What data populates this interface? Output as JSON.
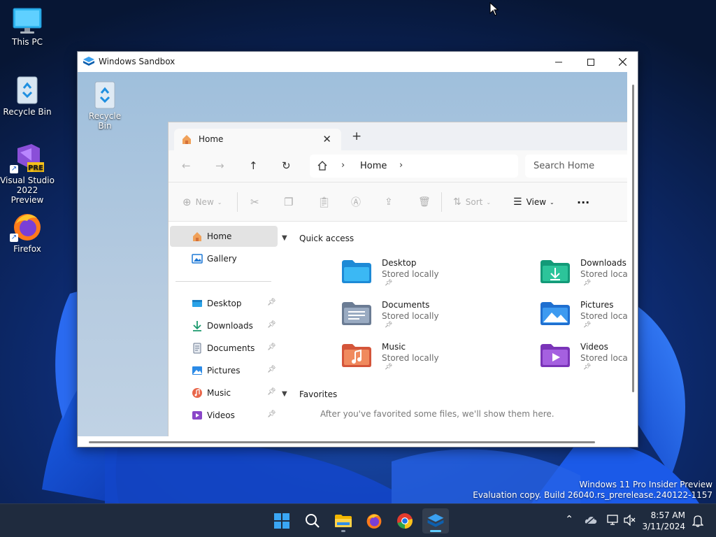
{
  "desktop": {
    "icons": [
      {
        "label": "This PC",
        "icon": "monitor-icon"
      },
      {
        "label": "Recycle Bin",
        "icon": "recycle-bin-icon"
      },
      {
        "label": "Visual Studio 2022 Preview",
        "icon": "visual-studio-icon",
        "badge": "PRE"
      },
      {
        "label": "Firefox",
        "icon": "firefox-icon"
      }
    ],
    "watermark": {
      "line1": "Windows 11 Pro Insider Preview",
      "line2": "Evaluation copy. Build 26040.rs_prerelease.240122-1157"
    }
  },
  "sandbox": {
    "title": "Windows Sandbox",
    "controls": [
      "minimize",
      "maximize",
      "close"
    ],
    "desktop_icon": "Recycle Bin"
  },
  "explorer": {
    "tab": {
      "label": "Home"
    },
    "breadcrumb": {
      "current": "Home"
    },
    "search": {
      "placeholder": "Search Home"
    },
    "toolbar": {
      "new": "New",
      "sort": "Sort",
      "view": "View"
    },
    "nav": {
      "top": [
        {
          "label": "Home",
          "icon": "home-icon",
          "selected": true
        },
        {
          "label": "Gallery",
          "icon": "gallery-icon"
        }
      ],
      "pinned": [
        {
          "label": "Desktop",
          "icon": "desktop-folder-icon"
        },
        {
          "label": "Downloads",
          "icon": "download-icon"
        },
        {
          "label": "Documents",
          "icon": "document-icon"
        },
        {
          "label": "Pictures",
          "icon": "pictures-icon"
        },
        {
          "label": "Music",
          "icon": "music-icon"
        },
        {
          "label": "Videos",
          "icon": "video-icon"
        }
      ]
    },
    "quick_access": {
      "heading": "Quick access",
      "items": [
        {
          "name": "Desktop",
          "status": "Stored locally"
        },
        {
          "name": "Downloads",
          "status": "Stored locally"
        },
        {
          "name": "Documents",
          "status": "Stored locally"
        },
        {
          "name": "Pictures",
          "status": "Stored locally"
        },
        {
          "name": "Music",
          "status": "Stored locally"
        },
        {
          "name": "Videos",
          "status": "Stored locally"
        }
      ]
    },
    "favorites": {
      "heading": "Favorites",
      "empty_text": "After you've favorited some files, we'll show them here."
    }
  },
  "taskbar": {
    "apps": [
      "start-icon",
      "search-icon",
      "file-explorer-icon",
      "firefox-icon",
      "chrome-icon",
      "sandbox-icon"
    ],
    "clock": {
      "time": "8:57 AM",
      "date": "3/11/2024"
    }
  }
}
